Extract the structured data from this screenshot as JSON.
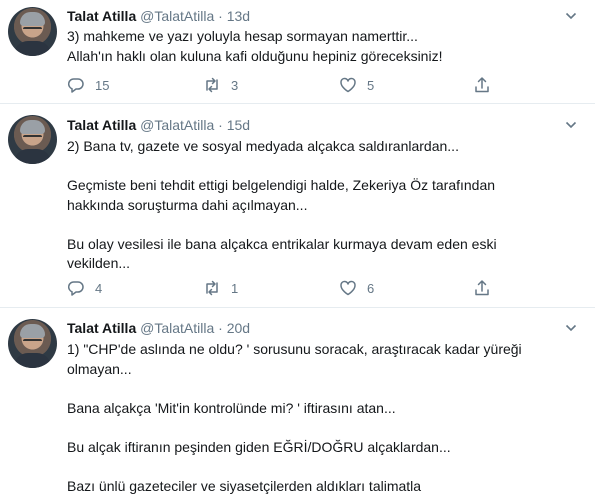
{
  "tweets": [
    {
      "name": "Talat Atilla",
      "handle": "@TalatAtilla",
      "separator": "·",
      "time": "13d",
      "lines": [
        "3) mahkeme ve yazı yoluyla hesap sormayan namerttir...",
        "Allah'ın haklı olan kuluna kafi olduğunu hepiniz  göreceksiniz!"
      ],
      "replies": "15",
      "retweets": "3",
      "likes": "5"
    },
    {
      "name": "Talat Atilla",
      "handle": "@TalatAtilla",
      "separator": "·",
      "time": "15d",
      "lines": [
        "2) Bana tv, gazete ve sosyal medyada alçakca saldıranlardan...",
        "Geçmiste beni tehdit ettigi belgelendigi halde, Zekeriya Öz tarafından",
        "hakkında soruşturma dahi açılmayan...",
        "Bu olay vesilesi ile bana alçakca entrikalar kurmaya devam eden eski",
        "vekilden..."
      ],
      "replies": "4",
      "retweets": "1",
      "likes": "6"
    },
    {
      "name": "Talat Atilla",
      "handle": "@TalatAtilla",
      "separator": "·",
      "time": "20d",
      "lines": [
        "1) \"CHP'de aslında ne oldu? ' sorusunu soracak, araştıracak  kadar yüreği",
        "olmayan...",
        "Bana alçakça 'Mit'in kontrolünde mi? ' iftirasını atan...",
        "Bu alçak iftiranın peşinden giden EĞRİ/DOĞRU alçaklardan...",
        "Bazı ünlü gazeteciler ve siyasetçilerden  aldıkları talimatla"
      ]
    }
  ],
  "icons": {
    "reply": "reply-icon",
    "retweet": "retweet-icon",
    "like": "heart-icon",
    "share": "share-icon",
    "more": "chevron-down-icon"
  },
  "colors": {
    "text": "#14171a",
    "secondary": "#657786",
    "divider": "#e6ecf0"
  }
}
